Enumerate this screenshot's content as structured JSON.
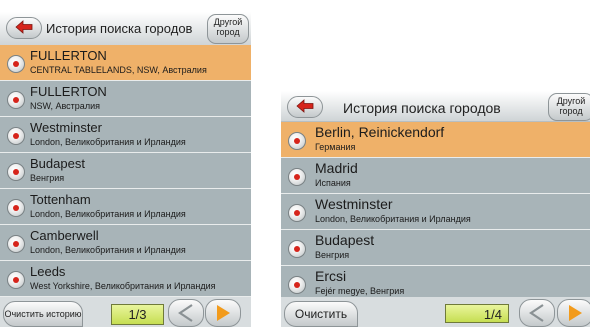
{
  "colors": {
    "selected_row": "#efb169",
    "row": "#a8b4b8",
    "page_box": "#c6de52",
    "arrow_orange": "#f29b1c",
    "back_red": "#d6241b"
  },
  "screen_a": {
    "title": "История поиска городов",
    "other_button": "Другой город",
    "rows": [
      {
        "name": "FULLERTON",
        "sub": "CENTRAL TABLELANDS, NSW, Австралия",
        "selected": true,
        "icon": "pin-icon"
      },
      {
        "name": "FULLERTON",
        "sub": "NSW, Австралия",
        "selected": false,
        "icon": "pin-icon"
      },
      {
        "name": "Westminster",
        "sub": "London, Великобритания и Ирландия",
        "selected": false,
        "icon": "pin-icon"
      },
      {
        "name": "Budapest",
        "sub": "Венгрия",
        "selected": false,
        "icon": "pin-icon"
      },
      {
        "name": "Tottenham",
        "sub": "London, Великобритания и Ирландия",
        "selected": false,
        "icon": "pin-icon"
      },
      {
        "name": "Camberwell",
        "sub": "London, Великобритания и Ирландия",
        "selected": false,
        "icon": "pin-icon"
      },
      {
        "name": "Leeds",
        "sub": "West Yorkshire, Великобритания и Ирландия",
        "selected": false,
        "icon": "pin-icon"
      }
    ],
    "clear_button": "Очистить историю",
    "page": "1/3"
  },
  "screen_b": {
    "title": "История поиска городов",
    "other_button": "Другой город",
    "rows": [
      {
        "name": "Berlin, Reinickendorf",
        "sub": "Германия",
        "selected": true,
        "icon": "pin-icon"
      },
      {
        "name": "Madrid",
        "sub": "Испания",
        "selected": false,
        "icon": "pin-icon"
      },
      {
        "name": "Westminster",
        "sub": "London, Великобритания и Ирландия",
        "selected": false,
        "icon": "pin-icon"
      },
      {
        "name": "Budapest",
        "sub": "Венгрия",
        "selected": false,
        "icon": "pin-icon"
      },
      {
        "name": "Ercsi",
        "sub": "Fejér megye, Венгрия",
        "selected": false,
        "icon": "pin-icon"
      }
    ],
    "clear_button": "Очистить",
    "page": "1/4"
  }
}
